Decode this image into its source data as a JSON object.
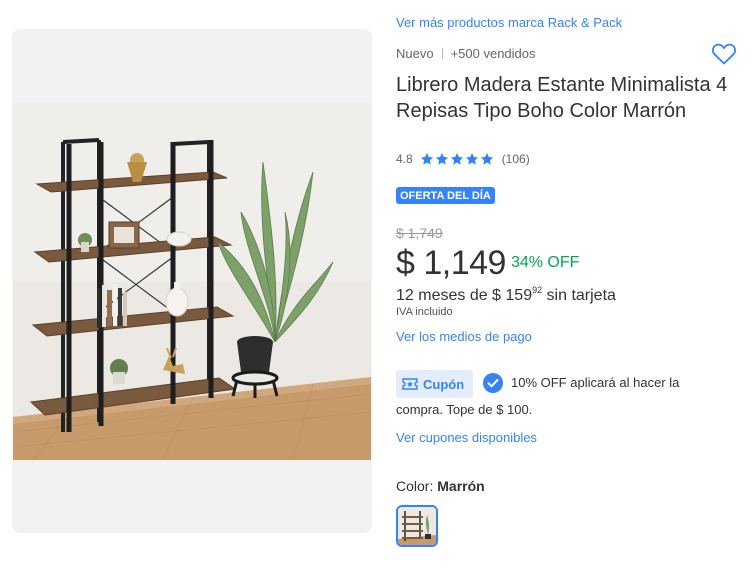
{
  "product": {
    "brand_link": "Ver más productos marca Rack & Pack",
    "condition": "Nuevo",
    "sold": "+500 vendidos",
    "title": "Librero Madera Estante Minimalista 4 Repisas Tipo Boho Color Marrón",
    "rating_value": "4.8",
    "rating_count": "(106)",
    "stars": 5,
    "deal_badge": "OFERTA DEL DÍA",
    "original_price": "$ 1,749",
    "price": "$ 1,149",
    "discount": "34% OFF",
    "installments_prefix": "12 meses de $ 159",
    "installments_cents": "92",
    "installments_suffix": " sin tarjeta",
    "tax_note": "IVA incluido",
    "payments_link": "Ver los medios de pago",
    "coupon_label": "Cupón",
    "coupon_text_line1": "10% OFF aplicará al hacer la",
    "coupon_text_line2": "compra. Tope de $ 100.",
    "coupons_link": "Ver cupones disponibles",
    "color_label": "Color:",
    "color_value": "Marrón"
  },
  "icons": {
    "favorite": "heart-outline-icon",
    "rating": "star-icon",
    "coupon": "ticket-icon",
    "applied": "check-circle-icon"
  },
  "colors": {
    "accent": "#3483fa",
    "discount_green": "#00a650",
    "text": "#333333",
    "muted": "#666666",
    "wood": "#7a5a3f",
    "frame": "#1e1e1e"
  }
}
